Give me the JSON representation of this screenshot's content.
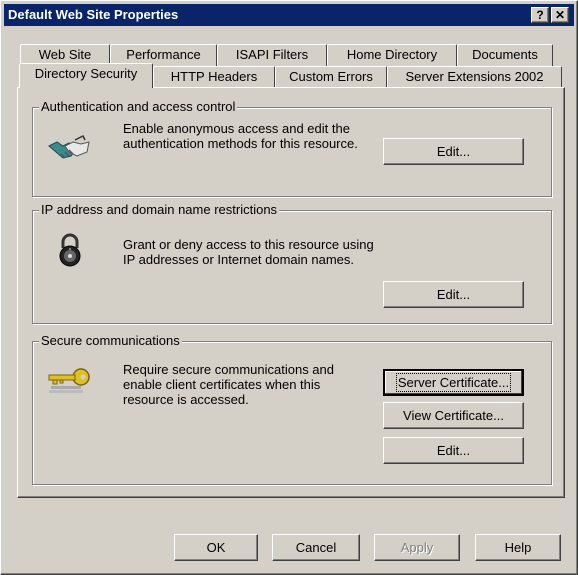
{
  "window": {
    "title": "Default Web Site Properties"
  },
  "title_buttons": {
    "help": "?",
    "close": "✕"
  },
  "tabs": {
    "row1": [
      "Web Site",
      "Performance",
      "ISAPI Filters",
      "Home Directory",
      "Documents"
    ],
    "row2": [
      "Directory Security",
      "HTTP Headers",
      "Custom Errors",
      "Server Extensions 2002"
    ],
    "active": "Directory Security"
  },
  "auth": {
    "legend": "Authentication and access control",
    "line1": "Enable anonymous access and edit the",
    "line2": "authentication methods for this resource.",
    "icon": "handshake-icon",
    "edit_label": "Edit..."
  },
  "ip": {
    "legend": "IP address and domain name restrictions",
    "line1": "Grant or deny access to this resource using",
    "line2": "IP addresses or Internet domain names.",
    "icon": "padlock-icon",
    "edit_label": "Edit..."
  },
  "secure": {
    "legend": "Secure communications",
    "line1": "Require secure communications and",
    "line2": "enable client certificates when this",
    "line3": "resource is accessed.",
    "icon": "key-icon",
    "server_cert_label": "Server Certificate...",
    "view_cert_label": "View Certificate...",
    "edit_label": "Edit..."
  },
  "footer": {
    "ok": "OK",
    "cancel": "Cancel",
    "apply": "Apply",
    "help": "Help"
  },
  "colors": {
    "titlebar": "#0a246a",
    "face": "#d4d0c8"
  }
}
